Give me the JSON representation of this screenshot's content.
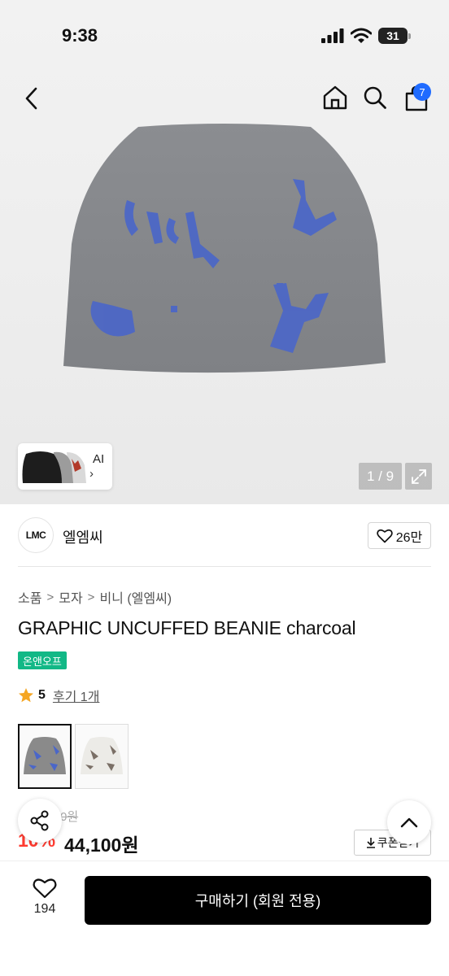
{
  "status_bar": {
    "time": "9:38",
    "battery": "31"
  },
  "header": {
    "cart_count": "7"
  },
  "icons": {
    "back": "chevron-left-icon",
    "home": "home-icon",
    "search": "search-icon",
    "cart": "shopping-bag-icon",
    "expand": "expand-icon",
    "heart": "heart-icon",
    "star": "star-icon",
    "share": "share-icon",
    "up": "chevron-up-icon",
    "download": "download-icon"
  },
  "gallery": {
    "ai_label": "AI",
    "ai_arrow": "›",
    "pager": "1 / 9"
  },
  "brand": {
    "logo_text": "LMC",
    "name": "엘엠씨",
    "likes": "26만"
  },
  "breadcrumb": [
    "소품",
    "모자",
    "비니 (엘엠씨)"
  ],
  "breadcrumb_sep": ">",
  "product": {
    "title": "GRAPHIC UNCUFFED BEANIE charcoal",
    "tag": "온앤오프",
    "rating": "5",
    "review_link": "후기 1개",
    "original_price_partial": "0원",
    "discount": "10%",
    "price": "44,100원",
    "coupon_label": "쿠폰받기"
  },
  "variants": [
    {
      "name": "charcoal",
      "color": "#8a8a8a"
    },
    {
      "name": "ivory",
      "color": "#ecebe7"
    }
  ],
  "bottom_bar": {
    "wish_count": "194",
    "buy_label": "구매하기 (회원 전용)"
  },
  "colors": {
    "accent_green": "#12b886",
    "badge_blue": "#1f6bff",
    "discount_red": "#ff3b30",
    "pattern_blue": "#4a66c9"
  }
}
